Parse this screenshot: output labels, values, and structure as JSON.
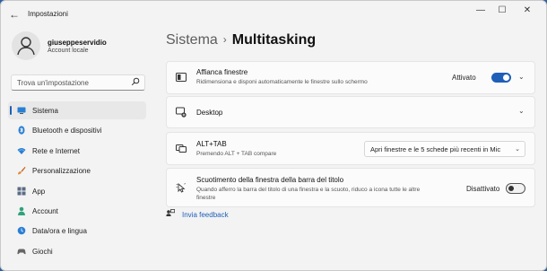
{
  "window": {
    "title": "Impostazioni",
    "back_glyph": "←",
    "minimize_glyph": "—",
    "maximize_glyph": "☐",
    "close_glyph": "✕"
  },
  "user": {
    "name": "giuseppeservidio",
    "account_type": "Account locale"
  },
  "search": {
    "placeholder": "Trova un'impostazione",
    "icon": "search-icon"
  },
  "sidebar": {
    "items": [
      {
        "label": "Sistema",
        "icon": "system-icon",
        "active": true
      },
      {
        "label": "Bluetooth e dispositivi",
        "icon": "bluetooth-icon"
      },
      {
        "label": "Rete e Internet",
        "icon": "wifi-icon"
      },
      {
        "label": "Personalizzazione",
        "icon": "brush-icon"
      },
      {
        "label": "App",
        "icon": "apps-icon"
      },
      {
        "label": "Account",
        "icon": "account-icon"
      },
      {
        "label": "Data/ora e lingua",
        "icon": "globe-clock-icon"
      },
      {
        "label": "Giochi",
        "icon": "gamepad-icon"
      }
    ]
  },
  "breadcrumb": {
    "parent": "Sistema",
    "separator": "›",
    "current": "Multitasking"
  },
  "settings": {
    "snap": {
      "title": "Affianca finestre",
      "description": "Ridimensiona e disponi automaticamente le finestre sullo schermo",
      "state": "Attivato",
      "on": true
    },
    "desktop": {
      "title": "Desktop"
    },
    "alttab": {
      "title": "ALT+TAB",
      "description": "Premendo ALT + TAB compare",
      "selected": "Apri finestre e le 5 schede più recenti in Mic"
    },
    "shake": {
      "title": "Scuotimento della finestra della barra del titolo",
      "description": "Quando afferro la barra del titolo di una finestra e la scuoto, riduco a icona tutte le altre finestre",
      "state": "Disattivato",
      "on": false
    }
  },
  "feedback": {
    "label": "Invia feedback"
  },
  "colors": {
    "accent": "#1f5fb8",
    "background": "#f3f3f3",
    "card": "#fbfbfb"
  }
}
